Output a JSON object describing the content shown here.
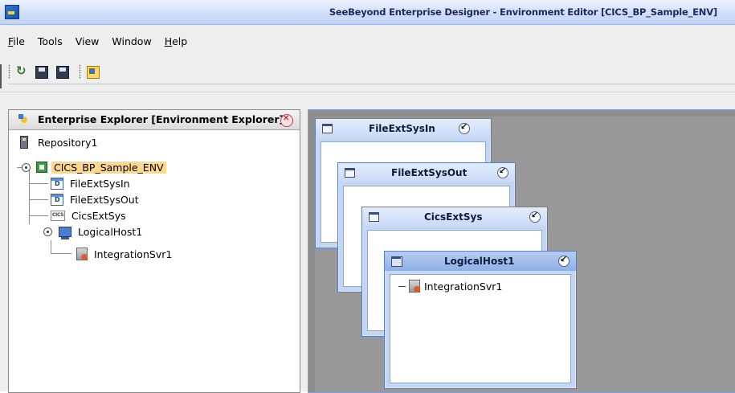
{
  "window": {
    "title": "SeeBeyond Enterprise Designer - Environment Editor [CICS_BP_Sample_ENV]",
    "app_icon": "seebeyond-app-icon"
  },
  "menubar": [
    {
      "label": "File",
      "mnemonic": "F",
      "rest": "ile"
    },
    {
      "label": "Tools",
      "mnemonic": "",
      "rest": "Tools"
    },
    {
      "label": "View",
      "mnemonic": "",
      "rest": "View"
    },
    {
      "label": "Window",
      "mnemonic": "",
      "rest": "Window"
    },
    {
      "label": "Help",
      "mnemonic": "H",
      "rest": "elp"
    }
  ],
  "toolbar": {
    "buttons": [
      "refresh-icon",
      "save-icon",
      "save-all-icon",
      "properties-icon"
    ]
  },
  "explorer": {
    "title": "Enterprise Explorer [Environment Explorer]",
    "tree": {
      "repository": "Repository1",
      "environment": "CICS_BP_Sample_ENV",
      "children": [
        "FileExtSysIn",
        "FileExtSysOut",
        "CicsExtSys",
        "LogicalHost1"
      ],
      "host_child": "IntegrationSvr1"
    }
  },
  "canvas": {
    "frames": [
      {
        "title": "FileExtSysIn"
      },
      {
        "title": "FileExtSysOut"
      },
      {
        "title": "CicsExtSys"
      },
      {
        "title": "LogicalHost1",
        "child": "IntegrationSvr1"
      }
    ]
  },
  "colors": {
    "selection": "#fcd88a",
    "canvas_bg": "#999999",
    "frame_border": "#5b7fbf"
  }
}
